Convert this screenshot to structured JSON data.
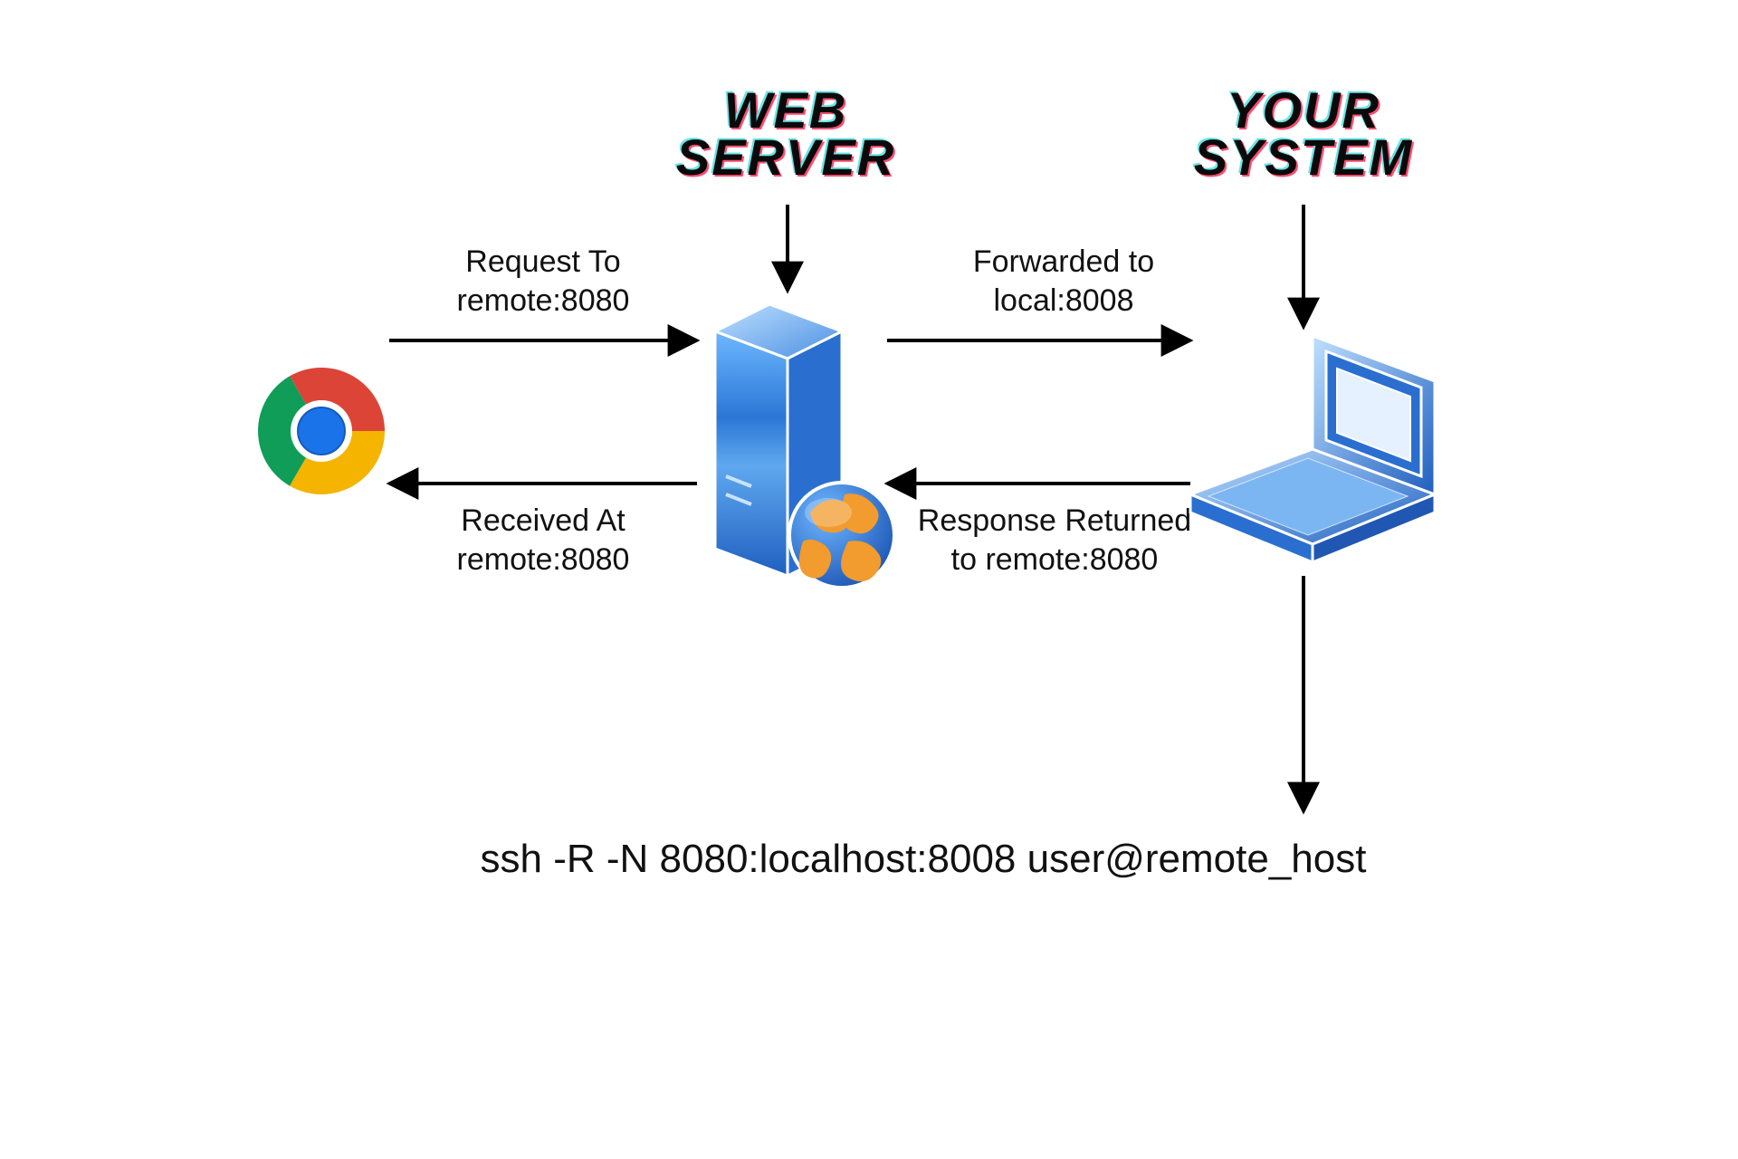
{
  "titles": {
    "web_server": "WEB\nSERVER",
    "your_system": "YOUR\nSYSTEM"
  },
  "flows": {
    "request": "Request To\nremote:8080",
    "received": "Received At\nremote:8080",
    "forwarded": "Forwarded to\nlocal:8008",
    "response": "Response Returned\nto remote:8080"
  },
  "command": "ssh -R -N 8080:localhost:8008 user@remote_host",
  "nodes": {
    "browser": "chrome-browser",
    "server": "web-server",
    "client": "your-system-laptop"
  }
}
